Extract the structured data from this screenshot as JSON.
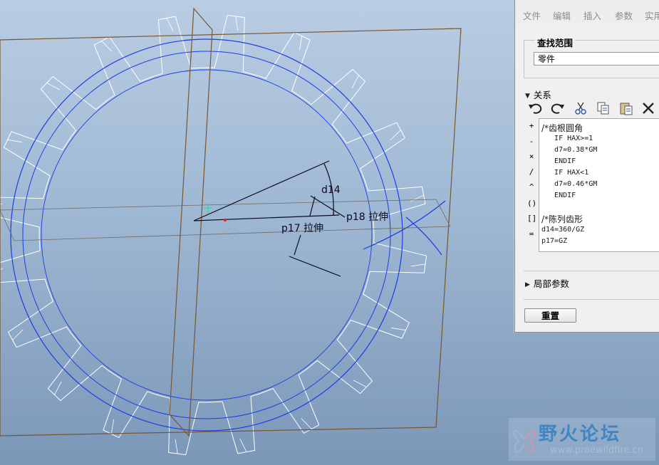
{
  "menu": {
    "items": [
      "文件",
      "编辑",
      "插入",
      "参数",
      "实用"
    ]
  },
  "scope": {
    "label": "查找范围",
    "value": "零件"
  },
  "relations": {
    "label": "关系",
    "tool_icons": [
      "undo-icon",
      "redo-icon",
      "cut-icon",
      "copy-icon",
      "paste-icon",
      "delete-icon"
    ],
    "operators": [
      "+",
      "-",
      "×",
      "/",
      "^",
      "()",
      "[]",
      "="
    ],
    "lines": [
      "/*齿根圆角",
      "   IF HAX>=1",
      "   d7=0.38*GM",
      "   ENDIF",
      "   IF HAX<1",
      "   d7=0.46*GM",
      "   ENDIF",
      "",
      "/*陈列齿形",
      "d14=360/GZ",
      "p17=GZ"
    ]
  },
  "local_params": {
    "label": "局部参数"
  },
  "reset_button": {
    "label": "重置"
  },
  "dimensions": {
    "d14": "d14",
    "p17": "p17 拉伸",
    "p18": "p18 拉伸"
  },
  "watermark": {
    "title": "野火论坛",
    "url": "www.proewildfire.cn"
  },
  "colors": {
    "viewport_top": "#b9cde3",
    "viewport_bottom": "#7b97b8",
    "gear_edges": "#ffffff",
    "datum_circle": "#1a3ee6",
    "datum_plane": "#7a5530",
    "dimension": "#0a0a1e"
  }
}
